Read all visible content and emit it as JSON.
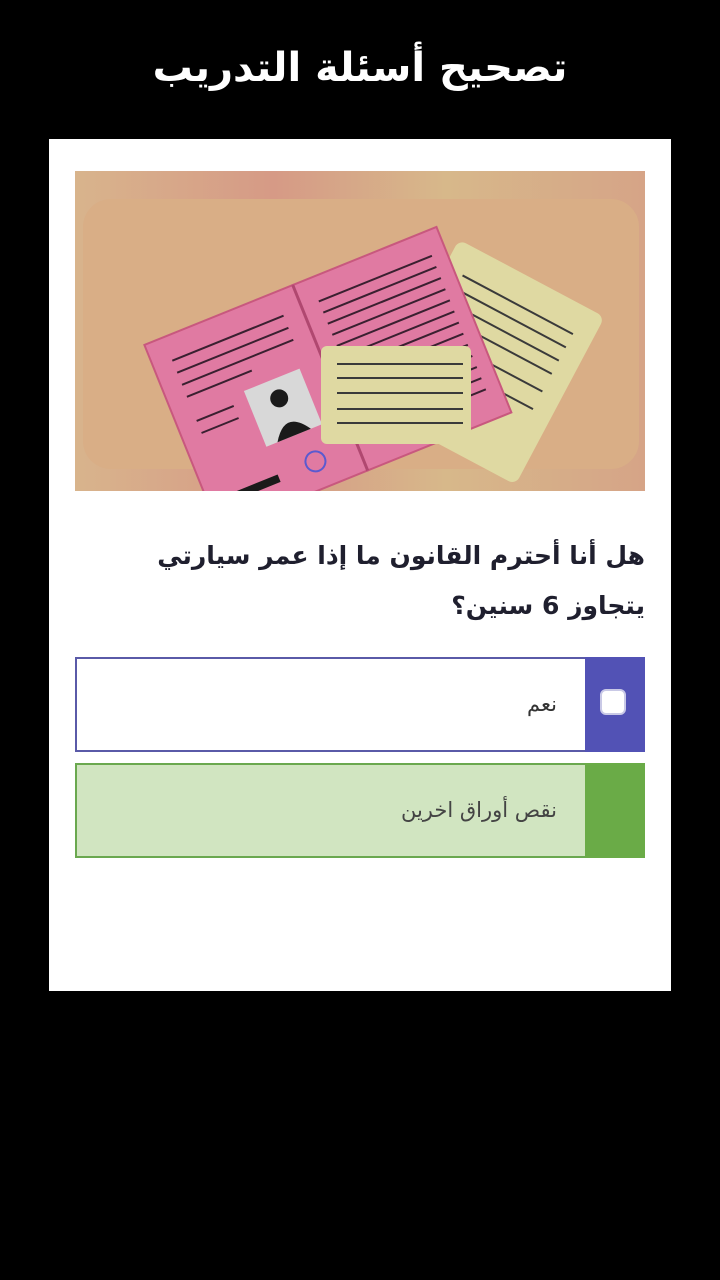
{
  "header": {
    "title": "تصحيح أسئلة التدريب"
  },
  "quiz": {
    "illustration_icon": "documents-illustration",
    "question": "هل أنا أحترم القانون ما إذا عمر سيارتي يتجاوز 6 سنين؟",
    "answers": [
      {
        "label": "نعم",
        "state": "unchecked",
        "accent": "#5252b5"
      },
      {
        "label": "نقص أوراق اخرين",
        "state": "correct",
        "accent": "#6aab47"
      }
    ]
  },
  "colors": {
    "background": "#000000",
    "card": "#ffffff",
    "answer_selected_border": "#5a5aa8",
    "answer_correct_fill": "#d1e5c1"
  }
}
